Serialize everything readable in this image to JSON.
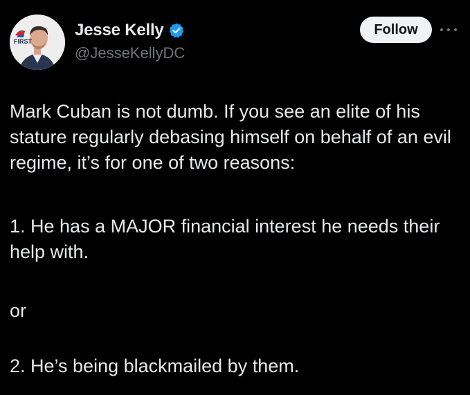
{
  "author": {
    "display_name": "Jesse Kelly",
    "handle": "@JesseKellyDC",
    "verified": true,
    "avatar_badge_text": "FIRST",
    "avatar_badge_subtext": "THE",
    "avatar_badge_small": "THEFIRSTTV.COM"
  },
  "actions": {
    "follow_label": "Follow",
    "more_icon": "more-horizontal-icon"
  },
  "tweet": {
    "paragraphs": [
      "Mark Cuban is not dumb. If you see an elite of his stature regularly debasing himself on behalf of an evil regime, it’s for one of two reasons:",
      "1. He has a MAJOR financial interest he needs their help with.",
      "or",
      "2. He’s being blackmailed by them."
    ]
  },
  "colors": {
    "background": "#000000",
    "text": "#e7e9ea",
    "secondary_text": "#71767b",
    "verified_blue": "#1d9bf0",
    "follow_bg": "#eff3f4",
    "follow_text": "#0f1419"
  }
}
